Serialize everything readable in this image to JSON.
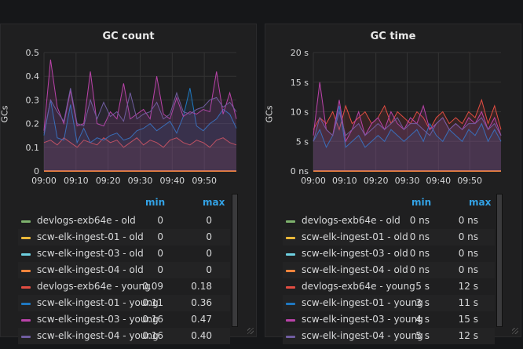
{
  "panels": [
    {
      "title": "GC count",
      "ylabel": "GCs",
      "legend_headers": {
        "min": "min",
        "max": "max"
      },
      "chart_data": {
        "type": "line",
        "title": "GC count",
        "ylabel": "GCs",
        "ylim": [
          0,
          0.5
        ],
        "yticks": [
          "0",
          "0.1",
          "0.2",
          "0.3",
          "0.4",
          "0.5"
        ],
        "yvals": [
          0,
          0.1,
          0.2,
          0.3,
          0.4,
          0.5
        ],
        "xticks": [
          "09:00",
          "09:10",
          "09:20",
          "09:30",
          "09:40",
          "09:50"
        ],
        "grid": true,
        "series": [
          {
            "name": "devlogs-exb64e - old",
            "color": "#7eb26d",
            "min": "0",
            "max": "0",
            "values": [
              0
            ]
          },
          {
            "name": "scw-elk-ingest-01 - old",
            "color": "#eab839",
            "min": "0",
            "max": "0",
            "values": [
              0
            ]
          },
          {
            "name": "scw-elk-ingest-03 - old",
            "color": "#6ed0e0",
            "min": "0",
            "max": "0",
            "values": [
              0
            ]
          },
          {
            "name": "scw-elk-ingest-04 - old",
            "color": "#ef843c",
            "min": "0",
            "max": "0",
            "values": [
              0
            ]
          },
          {
            "name": "devlogs-exb64e - young",
            "color": "#e24d42",
            "min": "0.09",
            "max": "0.18",
            "values": [
              0.12,
              0.13,
              0.11,
              0.14,
              0.12,
              0.1,
              0.13,
              0.12,
              0.11,
              0.14,
              0.12,
              0.13,
              0.1,
              0.12,
              0.14,
              0.11,
              0.13,
              0.12,
              0.1,
              0.13,
              0.14,
              0.12,
              0.11,
              0.13,
              0.12,
              0.1,
              0.13,
              0.14,
              0.12,
              0.11
            ]
          },
          {
            "name": "scw-elk-ingest-01 - young",
            "color": "#1f78c1",
            "min": "0.11",
            "max": "0.36",
            "values": [
              0.15,
              0.3,
              0.14,
              0.13,
              0.28,
              0.12,
              0.18,
              0.12,
              0.14,
              0.13,
              0.15,
              0.16,
              0.13,
              0.14,
              0.17,
              0.18,
              0.2,
              0.17,
              0.19,
              0.21,
              0.16,
              0.23,
              0.35,
              0.19,
              0.17,
              0.2,
              0.22,
              0.26,
              0.24,
              0.18
            ]
          },
          {
            "name": "scw-elk-ingest-03 - young",
            "color": "#ba43a9",
            "min": "0.16",
            "max": "0.47",
            "values": [
              0.17,
              0.47,
              0.27,
              0.2,
              0.34,
              0.19,
              0.2,
              0.42,
              0.2,
              0.19,
              0.25,
              0.22,
              0.37,
              0.22,
              0.24,
              0.26,
              0.22,
              0.4,
              0.24,
              0.22,
              0.31,
              0.23,
              0.25,
              0.24,
              0.26,
              0.25,
              0.42,
              0.24,
              0.33,
              0.22
            ]
          },
          {
            "name": "scw-elk-ingest-04 - young",
            "color": "#705da0",
            "min": "0.16",
            "max": "0.40",
            "values": [
              0.16,
              0.3,
              0.25,
              0.21,
              0.35,
              0.2,
              0.19,
              0.3,
              0.22,
              0.29,
              0.23,
              0.25,
              0.21,
              0.33,
              0.22,
              0.24,
              0.25,
              0.29,
              0.22,
              0.24,
              0.33,
              0.25,
              0.24,
              0.26,
              0.27,
              0.3,
              0.31,
              0.27,
              0.29,
              0.25
            ]
          }
        ]
      }
    },
    {
      "title": "GC time",
      "ylabel": "GCs",
      "legend_headers": {
        "min": "min",
        "max": "max"
      },
      "chart_data": {
        "type": "line",
        "title": "GC time",
        "ylabel": "GCs",
        "ylim": [
          0,
          20
        ],
        "yticks": [
          "0 ns",
          "5 s",
          "10 s",
          "15 s",
          "20 s"
        ],
        "yvals": [
          0,
          5,
          10,
          15,
          20
        ],
        "xticks": [
          "09:00",
          "09:10",
          "09:20",
          "09:30",
          "09:40",
          "09:50"
        ],
        "grid": true,
        "series": [
          {
            "name": "devlogs-exb64e - old",
            "color": "#7eb26d",
            "min": "0 ns",
            "max": "0 ns",
            "values": [
              0
            ]
          },
          {
            "name": "scw-elk-ingest-01 - old",
            "color": "#eab839",
            "min": "0 ns",
            "max": "0 ns",
            "values": [
              0
            ]
          },
          {
            "name": "scw-elk-ingest-03 - old",
            "color": "#6ed0e0",
            "min": "0 ns",
            "max": "0 ns",
            "values": [
              0
            ]
          },
          {
            "name": "scw-elk-ingest-04 - old",
            "color": "#ef843c",
            "min": "0 ns",
            "max": "0 ns",
            "values": [
              0
            ]
          },
          {
            "name": "devlogs-exb64e - young",
            "color": "#e24d42",
            "min": "5 s",
            "max": "12 s",
            "values": [
              7,
              9,
              8,
              10,
              7,
              11,
              8,
              9,
              10,
              8,
              9,
              11,
              8,
              10,
              9,
              8,
              10,
              9,
              7,
              9,
              10,
              8,
              9,
              8,
              10,
              9,
              12,
              8,
              11,
              7
            ]
          },
          {
            "name": "scw-elk-ingest-01 - young",
            "color": "#1f78c1",
            "min": "3 s",
            "max": "11 s",
            "values": [
              5,
              7,
              4,
              6,
              11,
              4,
              5,
              6,
              4,
              5,
              6,
              5,
              7,
              6,
              5,
              6,
              7,
              5,
              8,
              6,
              5,
              7,
              6,
              5,
              7,
              6,
              8,
              5,
              7,
              5
            ]
          },
          {
            "name": "scw-elk-ingest-03 - young",
            "color": "#ba43a9",
            "min": "4 s",
            "max": "15 s",
            "values": [
              6,
              15,
              7,
              6,
              12,
              5,
              7,
              10,
              6,
              8,
              9,
              7,
              10,
              8,
              7,
              9,
              8,
              11,
              7,
              8,
              9,
              7,
              8,
              7,
              9,
              8,
              10,
              7,
              9,
              6
            ]
          },
          {
            "name": "scw-elk-ingest-04 - young",
            "color": "#705da0",
            "min": "5 s",
            "max": "12 s",
            "values": [
              5,
              9,
              7,
              6,
              10,
              6,
              7,
              8,
              6,
              7,
              8,
              7,
              8,
              9,
              7,
              8,
              8,
              7,
              6,
              8,
              9,
              7,
              8,
              7,
              8,
              8,
              9,
              7,
              8,
              6
            ]
          }
        ]
      }
    }
  ]
}
